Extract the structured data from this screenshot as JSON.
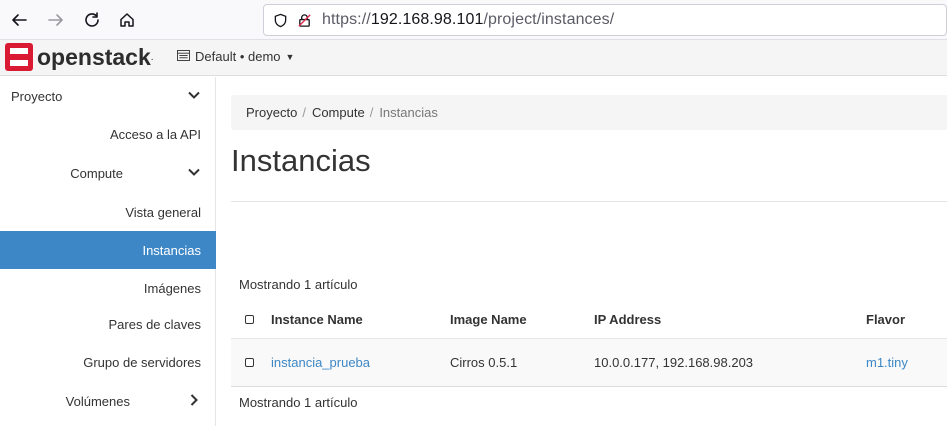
{
  "browser": {
    "url_scheme": "https://",
    "url_host": "192.168.98.101",
    "url_path": "/project/instances/"
  },
  "header": {
    "logo_text": "openstack",
    "logo_dot": ".",
    "domain": "Default",
    "separator": "•",
    "project": "demo",
    "brand_color": "#da1a32"
  },
  "sidebar": {
    "items": [
      {
        "label": "Proyecto"
      },
      {
        "label": "Acceso a la API"
      },
      {
        "label": "Compute"
      },
      {
        "label": "Vista general"
      },
      {
        "label": "Instancias"
      },
      {
        "label": "Imágenes"
      },
      {
        "label": "Pares de claves"
      },
      {
        "label": "Grupo de servidores"
      },
      {
        "label": "Volúmenes"
      }
    ],
    "active_color": "#3d87c6"
  },
  "breadcrumb": {
    "items": [
      "Proyecto",
      "Compute",
      "Instancias"
    ],
    "separator": "/"
  },
  "page": {
    "title": "Instancias",
    "count_top": "Mostrando 1 artículo",
    "count_bottom": "Mostrando 1 artículo"
  },
  "table": {
    "headers": [
      "Instance Name",
      "Image Name",
      "IP Address",
      "Flavor"
    ],
    "rows": [
      {
        "name": "instancia_prueba",
        "image": "Cirros 0.5.1",
        "ip": "10.0.0.177, 192.168.98.203",
        "flavor": "m1.tiny"
      }
    ]
  }
}
